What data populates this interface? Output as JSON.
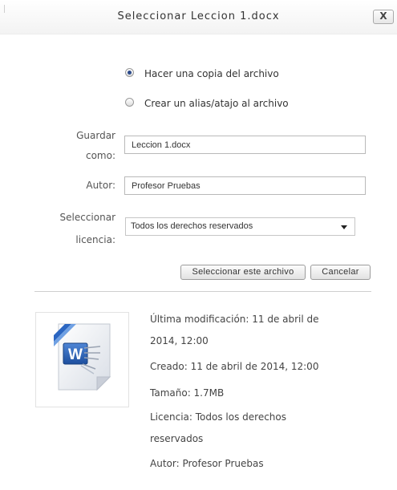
{
  "dialog": {
    "title": "Seleccionar Leccion 1.docx",
    "close_label": "X"
  },
  "options": {
    "copy_label": "Hacer una copia del archivo",
    "alias_label": "Crear un alias/atajo al archivo",
    "selected": "copy"
  },
  "form": {
    "save_as_label_line1": "Guardar",
    "save_as_label_line2": "como:",
    "save_as_value": "Leccion 1.docx",
    "author_label": "Autor:",
    "author_value": "Profesor Pruebas",
    "license_label_line1": "Seleccionar",
    "license_label_line2": "licencia:",
    "license_value": "Todos los derechos reservados"
  },
  "buttons": {
    "select_label": "Seleccionar este archivo",
    "cancel_label": "Cancelar"
  },
  "file_info": {
    "icon": "word-document-icon",
    "modified_line1": "Última modificación: 11 de abril de",
    "modified_line2": "2014, 12:00",
    "created": "Creado: 11 de abril de 2014, 12:00",
    "size": "Tamaño: 1.7MB",
    "license_line1": "Licencia: Todos los derechos",
    "license_line2": "reservados",
    "author": "Autor: Profesor Pruebas"
  }
}
